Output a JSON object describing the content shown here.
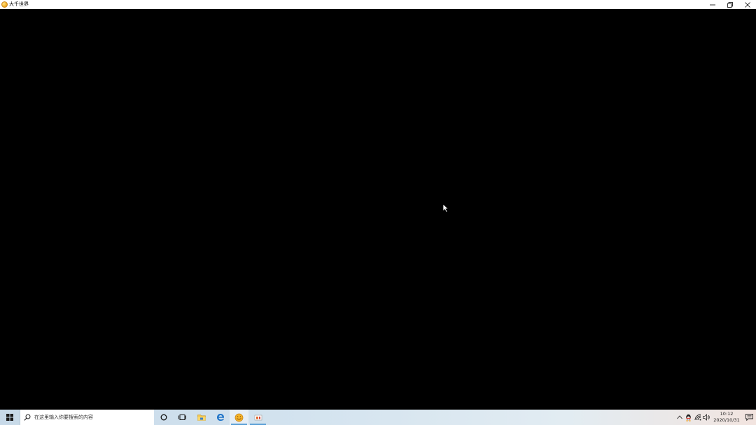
{
  "window": {
    "title": "大千世界",
    "icon": "app-smiley-icon"
  },
  "window_controls": {
    "minimize_icon": "minimize-icon",
    "restore_icon": "restore-icon",
    "close_icon": "close-icon"
  },
  "taskbar": {
    "start_icon": "windows-logo-icon",
    "search": {
      "icon": "search-icon",
      "placeholder": "在这里输入你要搜索的内容"
    },
    "pinned": [
      {
        "name": "cortana",
        "icon": "cortana-circle-icon"
      },
      {
        "name": "task-view",
        "icon": "task-view-icon"
      },
      {
        "name": "file-explorer",
        "icon": "folder-icon"
      },
      {
        "name": "edge",
        "icon": "edge-browser-icon"
      },
      {
        "name": "app",
        "icon": "app-smiley-icon"
      },
      {
        "name": "app2",
        "icon": "app-window-icon"
      }
    ],
    "tray": {
      "icons": [
        "chevron-up-icon",
        "qq-penguin-icon",
        "network-icon",
        "volume-icon"
      ],
      "time": "10:12",
      "date": "2020/10/31",
      "notification_icon": "notification-icon"
    }
  },
  "colors": {
    "content_background": "#000000",
    "taskbar_accent": "#5a9fd6"
  }
}
